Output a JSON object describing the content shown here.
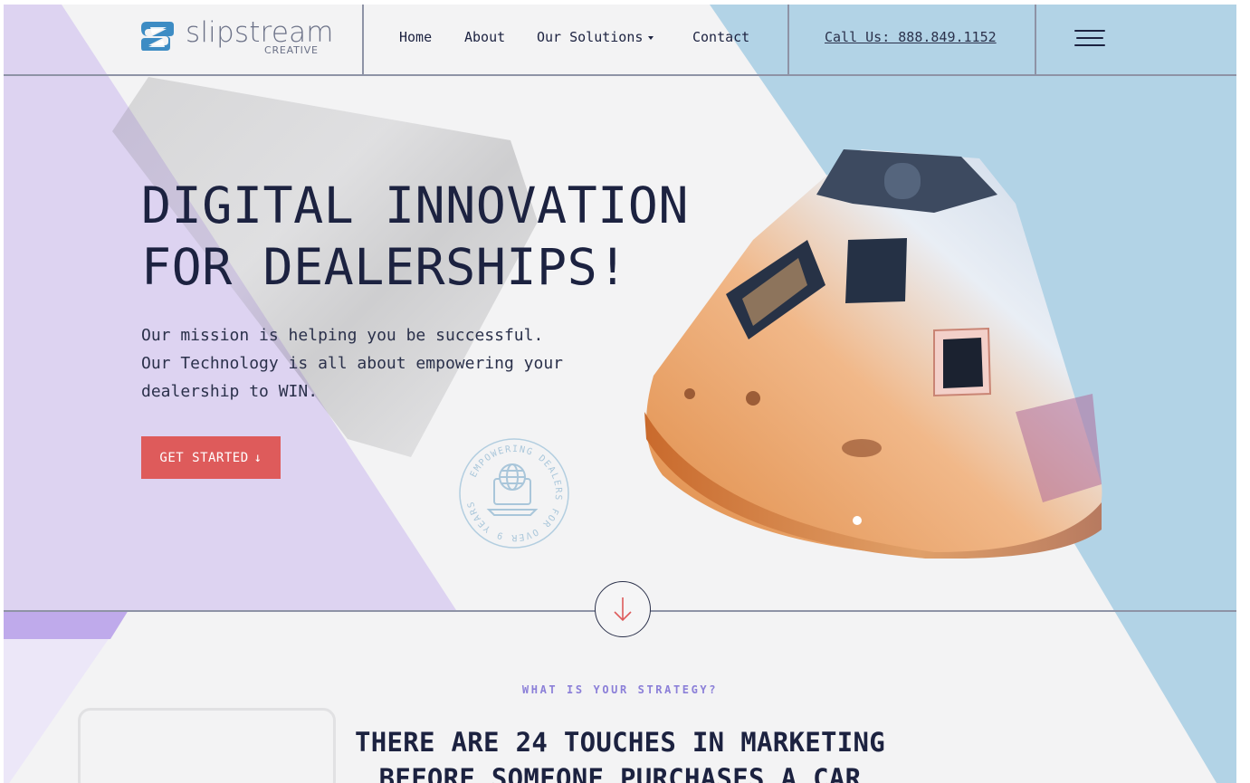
{
  "brand": {
    "name": "slipstream",
    "sub": "CREATIVE",
    "mark_color": "#3d8cc4"
  },
  "nav": {
    "home": "Home",
    "about": "About",
    "solutions": "Our Solutions",
    "contact": "Contact"
  },
  "header": {
    "phone": "Call Us: 888.849.1152"
  },
  "hero": {
    "title_line1": "DIGITAL INNOVATION",
    "title_line2": "FOR DEALERSHIPS!",
    "text_line1": "Our mission is helping you be successful.",
    "text_line2": "Our Technology is all about empowering your",
    "text_line3": "dealership to WIN.",
    "cta_label": "GET STARTED",
    "cta_arrow": "↓",
    "badge_text": "EMPOWERING DEALERS FOR OVER 9 YEARS"
  },
  "strategy": {
    "eyebrow": "WHAT IS YOUR STRATEGY?",
    "title_line1": "THERE ARE 24 TOUCHES IN MARKETING",
    "title_line2": "BEFORE SOMEONE PURCHASES A CAR"
  },
  "colors": {
    "purple": "#ddd3f1",
    "blue": "#b2d3e6",
    "cta": "#de5b5b",
    "navy": "#1c2240",
    "eyebrow": "#8b7fd8"
  },
  "icons": {
    "menu": "hamburger-menu-icon",
    "scroll": "arrow-down-icon",
    "badge": "globe-laptop-icon"
  }
}
